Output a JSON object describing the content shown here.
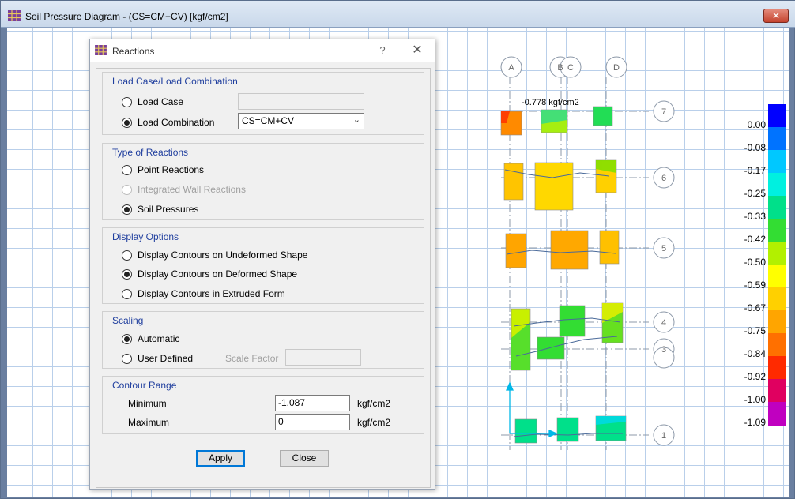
{
  "main": {
    "title": "Soil Pressure Diagram - (CS=CM+CV)  [kgf/cm2]",
    "close_glyph": "✕",
    "icon": "grid-app-icon"
  },
  "plan": {
    "grid_columns": [
      "A",
      "B",
      "C",
      "D"
    ],
    "grid_rows": [
      "7",
      "6",
      "5",
      "4",
      "3",
      "1"
    ],
    "annotation": "-0.778 kgf/cm2",
    "axis_icon": "xy-axes-icon"
  },
  "legend": {
    "labels": [
      "0.00",
      "-0.08",
      "-0.17",
      "-0.25",
      "-0.33",
      "-0.42",
      "-0.50",
      "-0.59",
      "-0.67",
      "-0.75",
      "-0.84",
      "-0.92",
      "-1.00",
      "-1.09"
    ],
    "colors": [
      "#0000ff",
      "#0073ff",
      "#00c8ff",
      "#00f0e0",
      "#00e08a",
      "#33dd33",
      "#b2f000",
      "#ffff00",
      "#ffd000",
      "#ffa500",
      "#ff7000",
      "#ff2a00",
      "#e00060",
      "#c000c0"
    ]
  },
  "dialog": {
    "title": "Reactions",
    "help_glyph": "?",
    "close_glyph": "✕",
    "load": {
      "group_title": "Load Case/Load Combination",
      "load_case_label": "Load Case",
      "load_case_value": "",
      "load_combination_label": "Load Combination",
      "load_combination_value": "CS=CM+CV",
      "selected": "Load Combination"
    },
    "reaction_type": {
      "group_title": "Type of Reactions",
      "options": [
        "Point Reactions",
        "Integrated Wall Reactions",
        "Soil Pressures"
      ],
      "selected": "Soil Pressures"
    },
    "display": {
      "group_title": "Display Options",
      "options": [
        "Display Contours on Undeformed Shape",
        "Display Contours on Deformed Shape",
        "Display Contours in Extruded Form"
      ],
      "selected": "Display Contours on Deformed Shape"
    },
    "scaling": {
      "group_title": "Scaling",
      "automatic_label": "Automatic",
      "user_defined_label": "User Defined",
      "scale_factor_label": "Scale Factor",
      "scale_factor_value": "",
      "selected": "Automatic"
    },
    "contour": {
      "group_title": "Contour Range",
      "minimum_label": "Minimum",
      "minimum_value": "-1.087",
      "maximum_label": "Maximum",
      "maximum_value": "0",
      "unit": "kgf/cm2"
    },
    "apply_label": "Apply",
    "close_label": "Close"
  }
}
